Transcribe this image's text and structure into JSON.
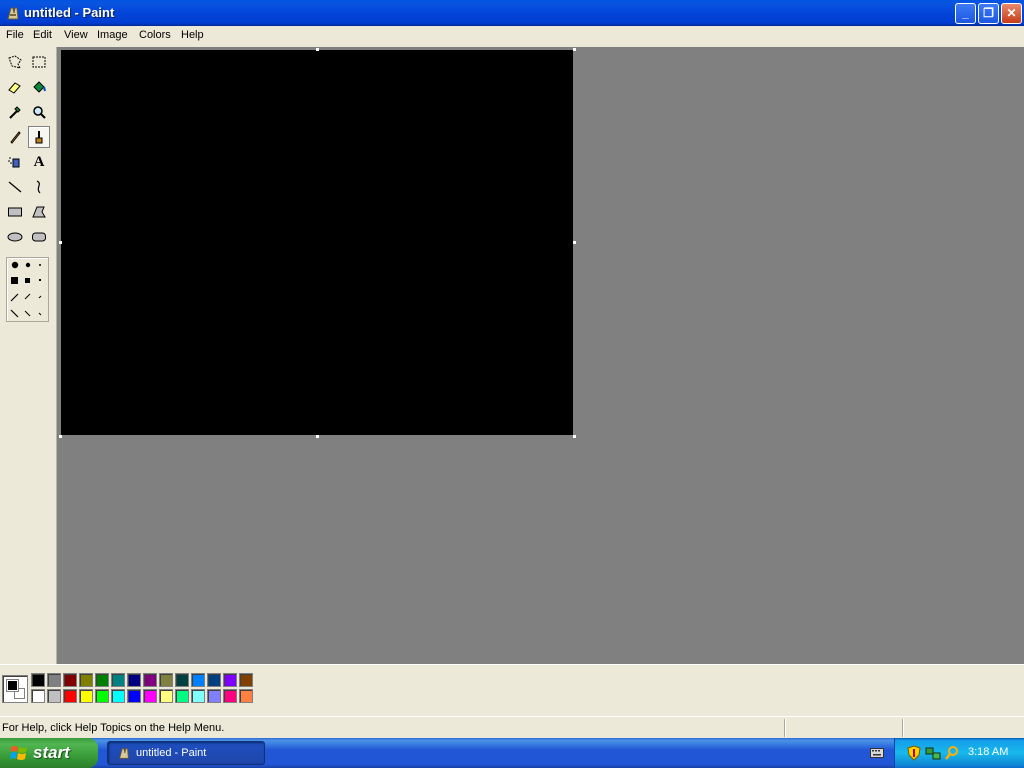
{
  "window": {
    "title": "untitled - Paint",
    "minimize_label": "_",
    "maximize_label": "❐",
    "close_label": "✕"
  },
  "menu": [
    "File",
    "Edit",
    "View",
    "Image",
    "Colors",
    "Help"
  ],
  "toolbox": {
    "tools": [
      "free-form-select-icon",
      "select-icon",
      "eraser-icon",
      "fill-bucket-icon",
      "pick-color-icon",
      "magnifier-icon",
      "pencil-icon",
      "brush-icon",
      "airbrush-icon",
      "text-icon",
      "line-icon",
      "curve-icon",
      "rectangle-icon",
      "polygon-icon",
      "ellipse-icon",
      "rounded-rectangle-icon"
    ],
    "selected_tool": "brush-icon",
    "text_tool_glyph": "A"
  },
  "canvas": {
    "fill_color": "#000000"
  },
  "palette": {
    "foreground": "#000000",
    "background": "#ffffff",
    "row1": [
      "#000000",
      "#808080",
      "#800000",
      "#808000",
      "#008000",
      "#008080",
      "#000080",
      "#800080",
      "#808040",
      "#004040",
      "#0080ff",
      "#004080",
      "#8000ff",
      "#804000"
    ],
    "row2": [
      "#ffffff",
      "#c0c0c0",
      "#ff0000",
      "#ffff00",
      "#00ff00",
      "#00ffff",
      "#0000ff",
      "#ff00ff",
      "#ffff80",
      "#00ff80",
      "#80ffff",
      "#8080ff",
      "#ff0080",
      "#ff8040"
    ]
  },
  "status": {
    "help_text": "For Help, click Help Topics on the Help Menu."
  },
  "taskbar": {
    "start_label": "start",
    "task_label": "untitled - Paint",
    "clock": "3:18 AM"
  }
}
